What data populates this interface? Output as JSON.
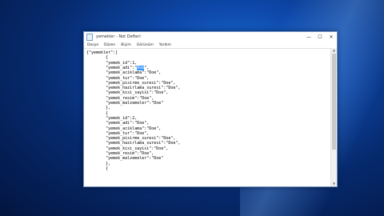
{
  "window": {
    "title": "yemekler - Not Defteri",
    "controls": {
      "minimize": "—",
      "maximize": "☐",
      "close": "✕"
    }
  },
  "menu": [
    "Dosya",
    "Düzen",
    "Biçim",
    "Görünüm",
    "Yardım"
  ],
  "editor": {
    "lines": [
      "{\"yemekler\":[",
      "        {",
      "        \"yemek_id\":1,",
      "        \"yemek_adi\":\"Doe\",",
      "        \"yemek_aciklama\":\"Doe\",",
      "        \"yemek_tur\":\"Doe\",",
      "        \"yemek_pisirme_suresi\":\"Doe\",",
      "        \"yemek_hazirlama_suresi\":\"Doe\",",
      "        \"yemek_kisi_sayisi\":\"Doe\",",
      "        \"yemek_resim\":\"Doe\",",
      "        \"yemek_malzemeler\":\"Doe\"",
      "        },",
      "        {",
      "        \"yemek_id\":2,",
      "        \"yemek_adi\":\"Doe\",",
      "        \"yemek_aciklama\":\"Doe\",",
      "        \"yemek_tur\":\"Doe\",",
      "        \"yemek_pisirme_suresi\":\"Doe\",",
      "        \"yemek_hazirlama_suresi\":\"Doe\",",
      "        \"yemek_kisi_sayisi\":\"Doe\",",
      "        \"yemek_resim\":\"Doe\",",
      "        \"yemek_malzemeler\":\"Doe\"",
      "        },",
      "        {"
    ],
    "selection": {
      "line": 3,
      "text": "Doe"
    }
  },
  "colors": {
    "selection": "#3399ff",
    "desktop": "#0d47a8"
  }
}
